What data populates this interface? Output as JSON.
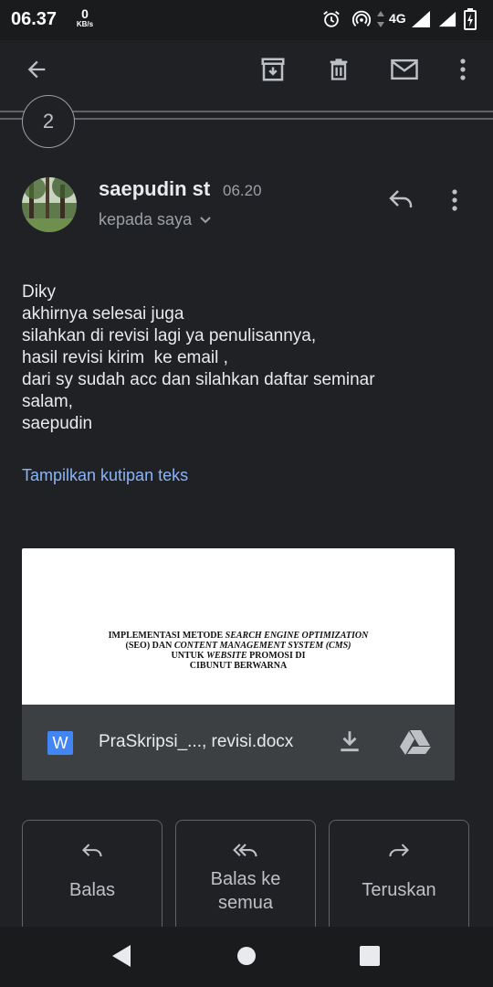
{
  "status": {
    "time": "06.37",
    "speed_value": "0",
    "speed_unit": "KB/s",
    "network": "4G"
  },
  "toolbar": {
    "back": "back-icon",
    "archive": "archive-icon",
    "delete": "delete-icon",
    "mark_unread": "mail-icon",
    "more": "more-icon"
  },
  "thread": {
    "collapsed_count": "2"
  },
  "message": {
    "sender": "saepudin st",
    "time": "06.20",
    "recipient": "kepada saya",
    "body_lines": [
      "Diky",
      "akhirnya selesai juga",
      "silahkan di revisi lagi ya penulisannya,",
      "hasil revisi kirim  ke email ,",
      "dari sy sudah acc dan silahkan daftar seminar",
      "salam,",
      "saepudin"
    ],
    "show_quoted": "Tampilkan kutipan teks"
  },
  "attachment": {
    "preview_line1a": "IMPLEMENTASI METODE ",
    "preview_line1b": "SEARCH ENGINE OPTIMIZATION",
    "preview_line2a": "(SEO) DAN ",
    "preview_line2b": "CONTENT MANAGEMENT SYSTEM (CMS)",
    "preview_line3a": "UNTUK ",
    "preview_line3b": "WEBSITE",
    "preview_line3c": " PROMOSI DI",
    "preview_line4": "CIBUNUT BERWARNA",
    "type_letter": "W",
    "filename": "PraSkripsi_..., revisi.docx"
  },
  "actions": {
    "reply": "Balas",
    "reply_all_1": "Balas ke",
    "reply_all_2": "semua",
    "forward": "Teruskan"
  },
  "colors": {
    "background": "#202124",
    "link": "#8ab4f8",
    "word_blue": "#4285f4",
    "card": "#3c4043"
  }
}
